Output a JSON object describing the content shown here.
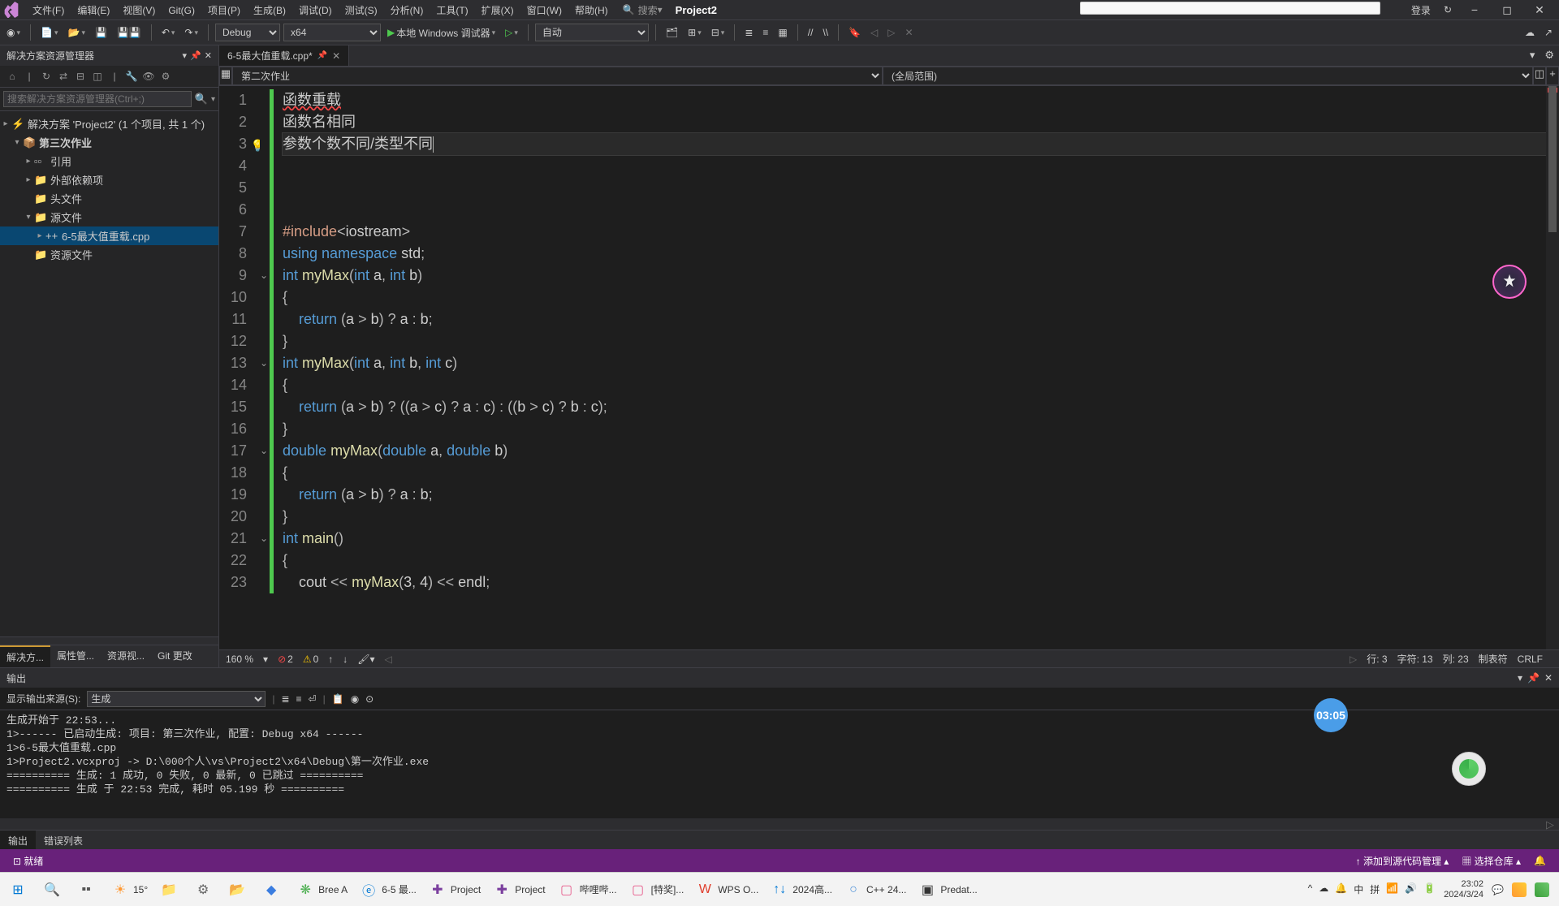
{
  "titlebar": {
    "menus": [
      "文件(F)",
      "编辑(E)",
      "视图(V)",
      "Git(G)",
      "项目(P)",
      "生成(B)",
      "调试(D)",
      "测试(S)",
      "分析(N)",
      "工具(T)",
      "扩展(X)",
      "窗口(W)",
      "帮助(H)"
    ],
    "search_placeholder": "搜索",
    "search_icon": "🔍",
    "project": "Project2",
    "login": "登录",
    "sync_icon": "↻"
  },
  "toolbar": {
    "config": "Debug",
    "platform": "x64",
    "debug_target": "本地 Windows 调试器",
    "auto": "自动"
  },
  "solution": {
    "title": "解决方案资源管理器",
    "search_placeholder": "搜索解决方案资源管理器(Ctrl+;)",
    "root": "解决方案 'Project2' (1 个项目, 共 1 个)",
    "project": "第三次作业",
    "items": [
      "引用",
      "外部依赖项",
      "头文件",
      "源文件",
      "6-5最大值重载.cpp",
      "资源文件"
    ]
  },
  "panel_tabs": [
    "解决方...",
    "属性管...",
    "资源视...",
    "Git 更改"
  ],
  "editor": {
    "tab_name": "6-5最大值重载.cpp*",
    "nav_left": "第二次作业",
    "nav_right": "(全局范围)",
    "lines": [
      {
        "n": 1,
        "plain": "函数重载",
        "err": true
      },
      {
        "n": 2,
        "plain": "函数名相同"
      },
      {
        "n": 3,
        "plain": "参数个数不同/类型不同",
        "current": true,
        "bulb": true
      },
      {
        "n": 4,
        "plain": ""
      },
      {
        "n": 5,
        "plain": ""
      },
      {
        "n": 6,
        "plain": ""
      },
      {
        "n": 7,
        "tokens": [
          [
            "str",
            "#include"
          ],
          [
            "op",
            "<"
          ],
          [
            "plain",
            "iostream"
          ],
          [
            "op",
            ">"
          ]
        ]
      },
      {
        "n": 8,
        "tokens": [
          [
            "kw",
            "using "
          ],
          [
            "kw",
            "namespace "
          ],
          [
            "plain",
            "std"
          ],
          [
            "op",
            ";"
          ]
        ]
      },
      {
        "n": 9,
        "fold": true,
        "tokens": [
          [
            "kw",
            "int "
          ],
          [
            "fn",
            "myMax"
          ],
          [
            "op",
            "("
          ],
          [
            "kw",
            "int "
          ],
          [
            "plain",
            "a"
          ],
          [
            "op",
            ", "
          ],
          [
            "kw",
            "int "
          ],
          [
            "plain",
            "b"
          ],
          [
            "op",
            ")"
          ]
        ]
      },
      {
        "n": 10,
        "tokens": [
          [
            "op",
            "{"
          ]
        ]
      },
      {
        "n": 11,
        "tokens": [
          [
            "plain",
            "    "
          ],
          [
            "kw",
            "return "
          ],
          [
            "op",
            "("
          ],
          [
            "plain",
            "a "
          ],
          [
            "op",
            ">"
          ],
          [
            "plain",
            " b"
          ],
          [
            "op",
            ") ? "
          ],
          [
            "plain",
            "a "
          ],
          [
            "op",
            ": "
          ],
          [
            "plain",
            "b"
          ],
          [
            "op",
            ";"
          ]
        ]
      },
      {
        "n": 12,
        "tokens": [
          [
            "op",
            "}"
          ]
        ]
      },
      {
        "n": 13,
        "fold": true,
        "tokens": [
          [
            "kw",
            "int "
          ],
          [
            "fn",
            "myMax"
          ],
          [
            "op",
            "("
          ],
          [
            "kw",
            "int "
          ],
          [
            "plain",
            "a"
          ],
          [
            "op",
            ", "
          ],
          [
            "kw",
            "int "
          ],
          [
            "plain",
            "b"
          ],
          [
            "op",
            ", "
          ],
          [
            "kw",
            "int "
          ],
          [
            "plain",
            "c"
          ],
          [
            "op",
            ")"
          ]
        ]
      },
      {
        "n": 14,
        "tokens": [
          [
            "op",
            "{"
          ]
        ]
      },
      {
        "n": 15,
        "tokens": [
          [
            "plain",
            "    "
          ],
          [
            "kw",
            "return "
          ],
          [
            "op",
            "("
          ],
          [
            "plain",
            "a "
          ],
          [
            "op",
            ">"
          ],
          [
            "plain",
            " b"
          ],
          [
            "op",
            ") ? (("
          ],
          [
            "plain",
            "a "
          ],
          [
            "op",
            ">"
          ],
          [
            "plain",
            " c"
          ],
          [
            "op",
            ") ? "
          ],
          [
            "plain",
            "a "
          ],
          [
            "op",
            ": "
          ],
          [
            "plain",
            "c"
          ],
          [
            "op",
            ") : (("
          ],
          [
            "plain",
            "b "
          ],
          [
            "op",
            ">"
          ],
          [
            "plain",
            " c"
          ],
          [
            "op",
            ") ? "
          ],
          [
            "plain",
            "b "
          ],
          [
            "op",
            ": "
          ],
          [
            "plain",
            "c"
          ],
          [
            "op",
            ");"
          ]
        ]
      },
      {
        "n": 16,
        "tokens": [
          [
            "op",
            "}"
          ]
        ]
      },
      {
        "n": 17,
        "fold": true,
        "tokens": [
          [
            "kw",
            "double "
          ],
          [
            "fn",
            "myMax"
          ],
          [
            "op",
            "("
          ],
          [
            "kw",
            "double "
          ],
          [
            "plain",
            "a"
          ],
          [
            "op",
            ", "
          ],
          [
            "kw",
            "double "
          ],
          [
            "plain",
            "b"
          ],
          [
            "op",
            ")"
          ]
        ]
      },
      {
        "n": 18,
        "tokens": [
          [
            "op",
            "{"
          ]
        ]
      },
      {
        "n": 19,
        "tokens": [
          [
            "plain",
            "    "
          ],
          [
            "kw",
            "return "
          ],
          [
            "op",
            "("
          ],
          [
            "plain",
            "a "
          ],
          [
            "op",
            ">"
          ],
          [
            "plain",
            " b"
          ],
          [
            "op",
            ") ? "
          ],
          [
            "plain",
            "a "
          ],
          [
            "op",
            ": "
          ],
          [
            "plain",
            "b"
          ],
          [
            "op",
            ";"
          ]
        ]
      },
      {
        "n": 20,
        "tokens": [
          [
            "op",
            "}"
          ]
        ]
      },
      {
        "n": 21,
        "fold": true,
        "tokens": [
          [
            "kw",
            "int "
          ],
          [
            "fn",
            "main"
          ],
          [
            "op",
            "()"
          ]
        ]
      },
      {
        "n": 22,
        "tokens": [
          [
            "op",
            "{"
          ]
        ]
      },
      {
        "n": 23,
        "tokens": [
          [
            "plain",
            "    cout "
          ],
          [
            "op",
            "<<"
          ],
          [
            "plain",
            " "
          ],
          [
            "fn",
            "myMax"
          ],
          [
            "op",
            "("
          ],
          [
            "plain",
            "3"
          ],
          [
            "op",
            ", "
          ],
          [
            "plain",
            "4"
          ],
          [
            "op",
            ") "
          ],
          [
            "op",
            "<<"
          ],
          [
            "plain",
            " endl"
          ],
          [
            "op",
            ";"
          ]
        ]
      }
    ]
  },
  "editor_status": {
    "zoom": "160 %",
    "error_count": "2",
    "warn_count": "0",
    "line": "行: 3",
    "char": "字符: 13",
    "col": "列: 23",
    "tabs": "制表符",
    "encoding": "CRLF"
  },
  "output": {
    "title": "输出",
    "source_label": "显示输出来源(S):",
    "source": "生成",
    "lines": [
      "生成开始于 22:53...",
      "1>------ 已启动生成: 项目: 第三次作业, 配置: Debug x64 ------",
      "1>6-5最大值重载.cpp",
      "1>Project2.vcxproj -> D:\\000个人\\vs\\Project2\\x64\\Debug\\第一次作业.exe",
      "========== 生成: 1 成功, 0 失败, 0 最新, 0 已跳过 ==========",
      "========== 生成 于 22:53 完成, 耗时 05.199 秒 =========="
    ]
  },
  "output_tabs": [
    "输出",
    "错误列表"
  ],
  "statusbar": {
    "ready": "就绪",
    "source_control": "添加到源代码管理",
    "select_repo": "选择仓库"
  },
  "timer": "03:05",
  "taskbar": {
    "items": [
      {
        "icon": "⊞",
        "color": "#0078d4"
      },
      {
        "icon": "🔍",
        "color": "#333"
      },
      {
        "icon": "▪▪",
        "color": "#555"
      },
      {
        "icon": "☀",
        "label": "15°",
        "color": "#ff9933"
      },
      {
        "icon": "📁",
        "color": "#f0c050"
      },
      {
        "icon": "⚙",
        "color": "#666"
      },
      {
        "icon": "📂",
        "color": "#f0c050"
      },
      {
        "icon": "◆",
        "color": "#3a7de0"
      },
      {
        "icon": "❋",
        "color": "#4caf50",
        "label": "Bree A"
      },
      {
        "icon": "ⓔ",
        "color": "#0078d4",
        "label": "6-5 最..."
      },
      {
        "icon": "✚",
        "color": "#7b3f9e",
        "label": "Project"
      },
      {
        "icon": "✚",
        "color": "#7b3f9e",
        "label": "Project"
      },
      {
        "icon": "▢",
        "color": "#e75c8c",
        "label": "哔哩哔..."
      },
      {
        "icon": "▢",
        "color": "#e75c8c",
        "label": "[特奖]..."
      },
      {
        "icon": "W",
        "color": "#e03e2d",
        "label": "WPS O..."
      },
      {
        "icon": "↑↓",
        "color": "#0078d4",
        "label": "2024高..."
      },
      {
        "icon": "○",
        "color": "#4a8fd8",
        "label": "C++ 24..."
      },
      {
        "icon": "▣",
        "color": "#333",
        "label": "Predat..."
      }
    ],
    "tray": [
      "^",
      "☁",
      "🔔",
      "中",
      "拼",
      "📶",
      "🔊",
      "🔋"
    ],
    "time": "23:02",
    "date": "2024/3/24"
  }
}
